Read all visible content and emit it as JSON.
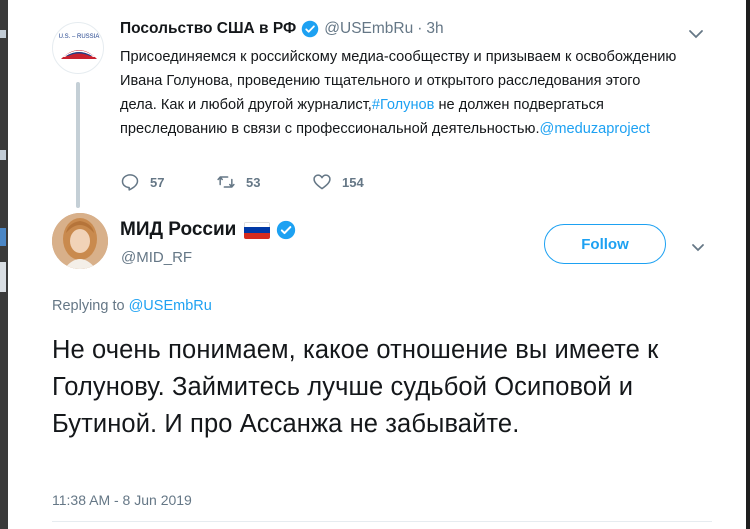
{
  "tweet1": {
    "display_name": "Посольство США в РФ",
    "handle": "@USEmbRu",
    "separator": "·",
    "time": "3h",
    "avatar_logo_text": "U.S. – RUSSIA",
    "text_before_hashtag": "Присоединяемся к российскому медиа-сообществу и призываем к освобождению Ивана Голунова, проведению тщательного и открытого расследования этого дела. Как и любой другой журналист,",
    "hashtag": "#Голунов",
    "text_after_hashtag": " не должен подвергаться преследованию в связи с профессиональной деятельностью.",
    "mention": "@meduzaproject",
    "replies": "57",
    "retweets": "53",
    "likes": "154",
    "icons": {
      "verified": "verified-badge-icon",
      "menu": "chevron-down-icon",
      "reply": "reply-icon",
      "retweet": "retweet-icon",
      "like": "heart-icon"
    }
  },
  "tweet2": {
    "display_name": "МИД России",
    "handle": "@MID_RF",
    "follow_label": "Follow",
    "replying_label": "Replying to ",
    "replying_handle": "@USEmbRu",
    "text": "Не очень понимаем, какое отношение вы имеете к Голунову. Займитесь лучше судьбой Осиповой и Бутиной. И про Ассанжа не забывайте.",
    "timestamp": "11:38 AM - 8 Jun 2019",
    "flag_colors": [
      "#ffffff",
      "#0039a6",
      "#d52b1e"
    ]
  },
  "colors": {
    "accent": "#1da1f2",
    "secondary_text": "#657786",
    "primary_text": "#14171a",
    "thread_line": "#c4cfd6"
  }
}
